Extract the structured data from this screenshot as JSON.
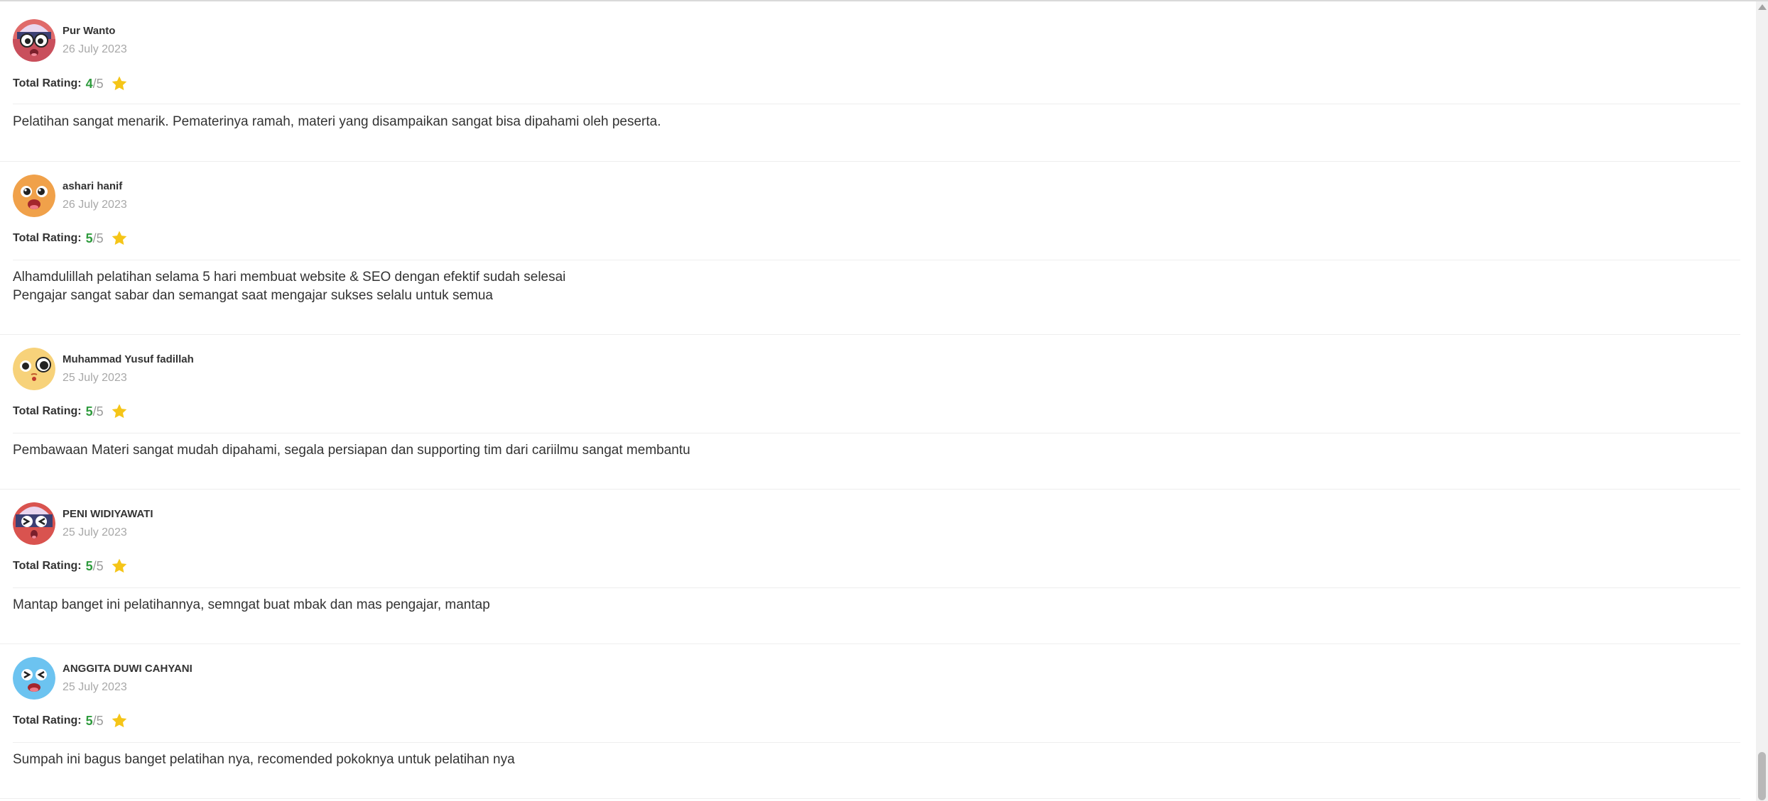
{
  "rating_label": "Total Rating:",
  "rating_max": "/5",
  "reviews": [
    {
      "name": "Pur Wanto",
      "date": "26 July 2023",
      "rating": "4",
      "lines": [
        "Pelatihan sangat menarik. Pematerinya ramah, materi yang disampaikan sangat bisa dipahami oleh peserta."
      ],
      "avatar": "orange-pink-helmet-face-icon"
    },
    {
      "name": "ashari hanif",
      "date": "26 July 2023",
      "rating": "5",
      "lines": [
        "Alhamdulillah pelatihan selama 5 hari membuat website & SEO dengan efektif sudah selesai",
        "Pengajar sangat sabar dan semangat saat mengajar sukses selalu untuk semua"
      ],
      "avatar": "orange-surprised-face-icon"
    },
    {
      "name": "Muhammad Yusuf fadillah",
      "date": "25 July 2023",
      "rating": "5",
      "lines": [
        "Pembawaan Materi sangat mudah dipahami, segala persiapan dan supporting tim dari cariilmu sangat membantu"
      ],
      "avatar": "yellow-googly-eyes-face-icon"
    },
    {
      "name": "PENI WIDIYAWATI",
      "date": "25 July 2023",
      "rating": "5",
      "lines": [
        "Mantap banget ini pelatihannya, semngat buat mbak dan mas pengajar, mantap"
      ],
      "avatar": "red-helmet-squint-face-icon"
    },
    {
      "name": "ANGGITA DUWI CAHYANI",
      "date": "25 July 2023",
      "rating": "5",
      "lines": [
        "Sumpah ini bagus banget pelatihan nya, recomended pokoknya untuk pelatihan nya"
      ],
      "avatar": "blue-squint-face-icon"
    }
  ],
  "colors": {
    "rating_value": "#2e9b3d",
    "star": "#f5c518",
    "text": "#333333",
    "date": "#a8a8a8"
  }
}
